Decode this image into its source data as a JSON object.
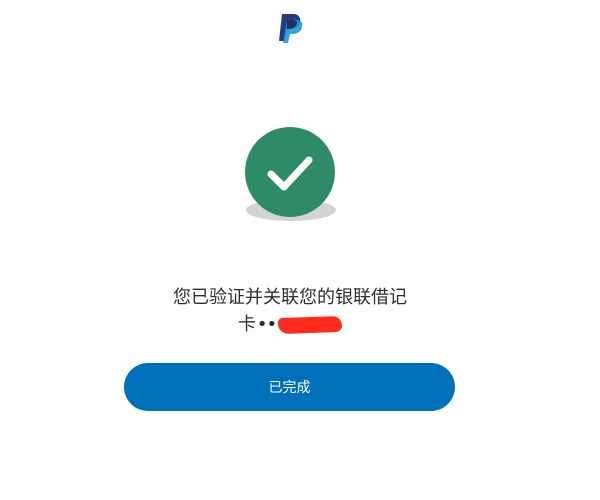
{
  "header": {
    "logo_icon": "paypal-logo-icon"
  },
  "status": {
    "icon": "success-check-icon",
    "icon_color": "#2e8b66",
    "message_line1": "您已验证并关联您的银联借记",
    "message_line2_prefix": "卡",
    "masked_card_dots": "••",
    "redaction_color": "#ff2b1c"
  },
  "actions": {
    "done_label": "已完成",
    "done_color": "#0070ba"
  }
}
